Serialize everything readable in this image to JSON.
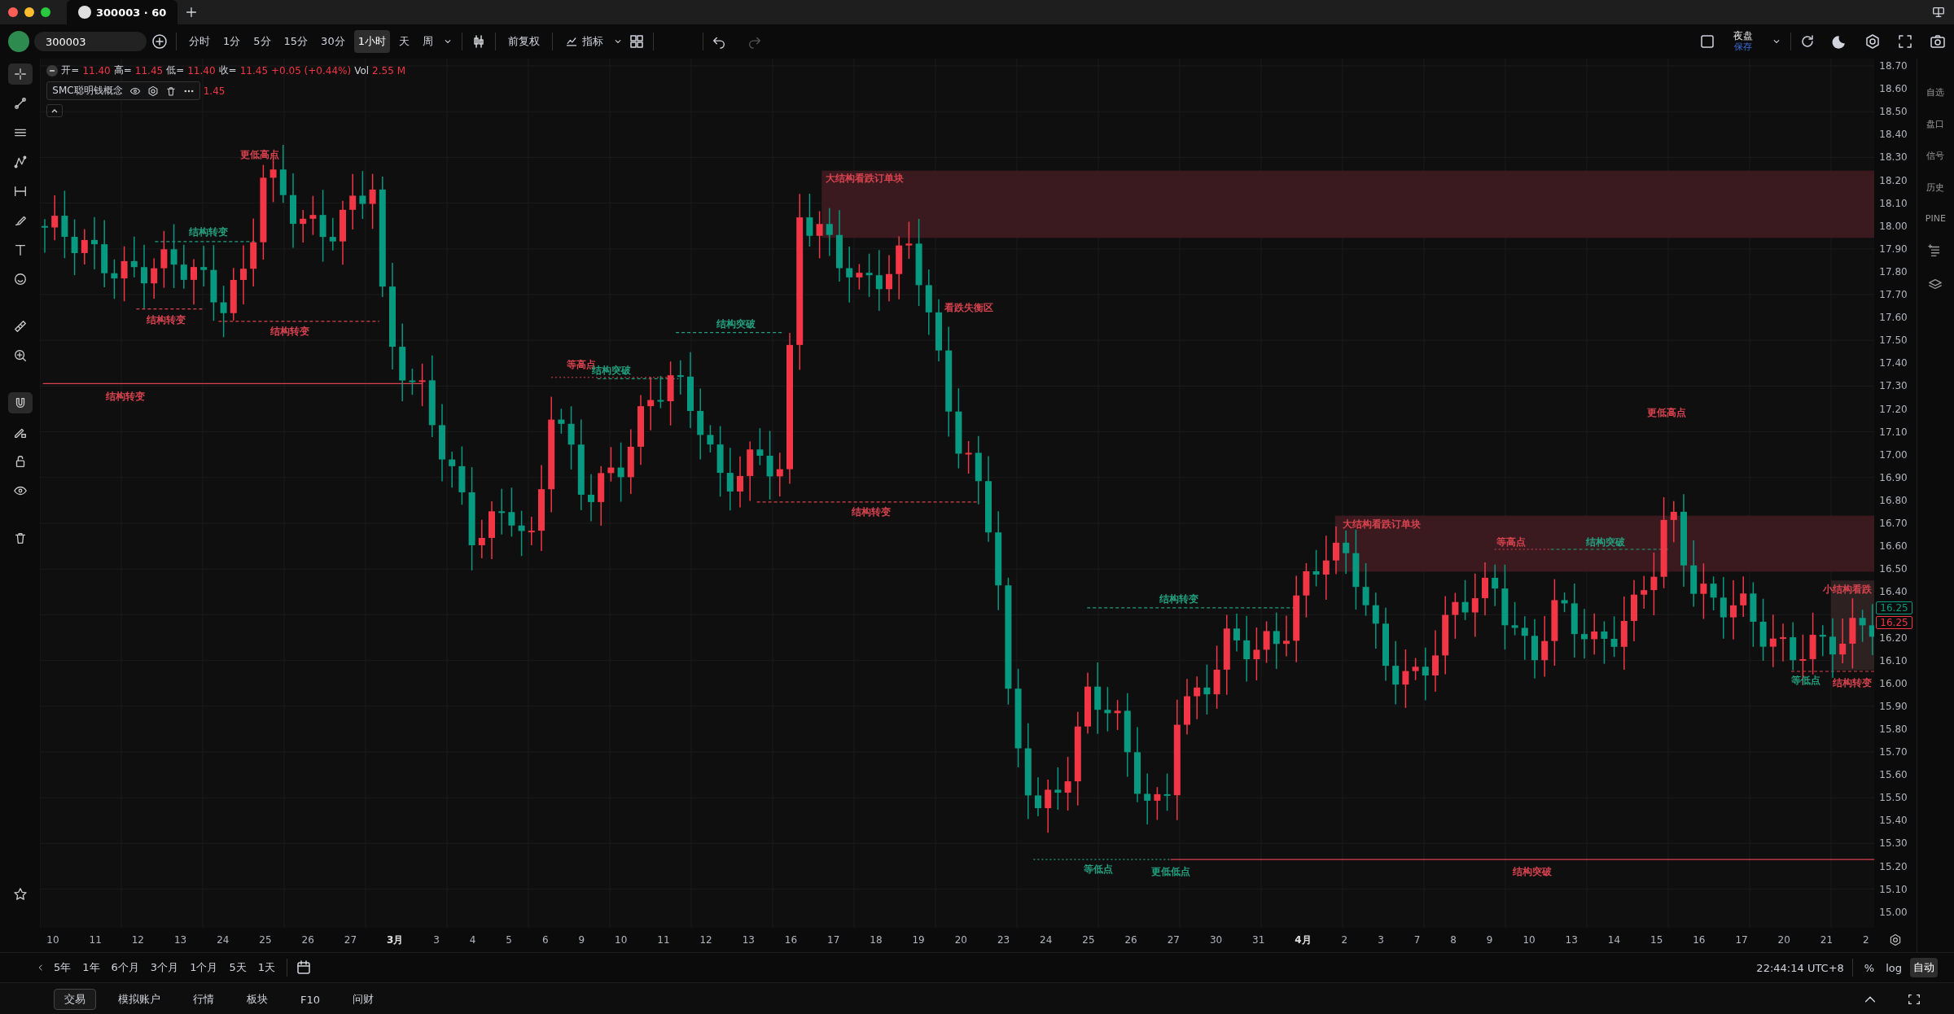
{
  "window": {
    "tab_title": "300003 · 60"
  },
  "toolbar": {
    "symbol": "300003",
    "intervals": [
      {
        "label": "分时",
        "selected": false
      },
      {
        "label": "1分",
        "selected": false
      },
      {
        "label": "5分",
        "selected": false
      },
      {
        "label": "15分",
        "selected": false
      },
      {
        "label": "30分",
        "selected": false
      },
      {
        "label": "1小时",
        "selected": true
      },
      {
        "label": "天",
        "selected": false
      },
      {
        "label": "周",
        "selected": false
      }
    ],
    "adjustment": "前复权",
    "indicators": "指标"
  },
  "session": {
    "label": "夜盘",
    "status": "保存"
  },
  "legend": {
    "fields": [
      {
        "label": "开=",
        "value": "11.40"
      },
      {
        "label": "高=",
        "value": "11.45"
      },
      {
        "label": "低=",
        "value": "11.40"
      },
      {
        "label": "收=",
        "value": "11.45"
      }
    ],
    "change": "+0.05 (+0.44%)",
    "volume_label": "Vol",
    "volume": "2.55 M"
  },
  "indicator": {
    "name": "SMC聪明钱概念",
    "value": "1.45"
  },
  "price_axis": {
    "labels": [
      "18.70",
      "18.60",
      "18.50",
      "18.40",
      "18.30",
      "18.20",
      "18.10",
      "18.00",
      "17.90",
      "17.80",
      "17.70",
      "17.60",
      "17.50",
      "17.40",
      "17.30",
      "17.20",
      "17.10",
      "17.00",
      "16.90",
      "16.80",
      "16.70",
      "16.60",
      "16.50",
      "16.40",
      "16.20",
      "16.10",
      "16.00",
      "15.90",
      "15.80",
      "15.70",
      "15.60",
      "15.50",
      "15.40",
      "15.30",
      "15.20",
      "15.10",
      "15.00"
    ],
    "badges": [
      {
        "text": "16.25",
        "color": "#089981"
      },
      {
        "text": "16.25",
        "color": "#f23645"
      }
    ]
  },
  "annotations": [
    {
      "text": "更低高点",
      "color": "#d9434f"
    },
    {
      "text": "结构转变",
      "color": "#22a07f"
    },
    {
      "text": "结构转变",
      "color": "#d9434f"
    },
    {
      "text": "结构转变",
      "color": "#d9434f"
    },
    {
      "text": "结构转变",
      "color": "#d9434f"
    },
    {
      "text": "等高点",
      "color": "#d9434f"
    },
    {
      "text": "结构突破",
      "color": "#22a07f"
    },
    {
      "text": "结构突破",
      "color": "#22a07f"
    },
    {
      "text": "大结构看跌订单块",
      "color": "#d9434f"
    },
    {
      "text": "看跌失衡区",
      "color": "#d9434f"
    },
    {
      "text": "结构转变",
      "color": "#d9434f"
    },
    {
      "text": "更低高点",
      "color": "#d9434f"
    },
    {
      "text": "大结构看跌订单块",
      "color": "#d9434f"
    },
    {
      "text": "等高点",
      "color": "#d9434f"
    },
    {
      "text": "结构突破",
      "color": "#22a07f"
    },
    {
      "text": "结构转变",
      "color": "#22a07f"
    },
    {
      "text": "等低点",
      "color": "#22a07f"
    },
    {
      "text": "更低低点",
      "color": "#22a07f"
    },
    {
      "text": "结构突破",
      "color": "#d9434f"
    },
    {
      "text": "小结构看跌",
      "color": "#d9434f"
    },
    {
      "text": "等低点",
      "color": "#22a07f"
    },
    {
      "text": "结构转变",
      "color": "#d9434f"
    }
  ],
  "date_axis": [
    {
      "label": "10",
      "kind": "day"
    },
    {
      "label": "11",
      "kind": "day"
    },
    {
      "label": "12",
      "kind": "day"
    },
    {
      "label": "13",
      "kind": "day"
    },
    {
      "label": "24",
      "kind": "day"
    },
    {
      "label": "25",
      "kind": "day"
    },
    {
      "label": "26",
      "kind": "day"
    },
    {
      "label": "27",
      "kind": "day"
    },
    {
      "label": "3月",
      "kind": "month"
    },
    {
      "label": "3",
      "kind": "day"
    },
    {
      "label": "4",
      "kind": "day"
    },
    {
      "label": "5",
      "kind": "day"
    },
    {
      "label": "6",
      "kind": "day"
    },
    {
      "label": "9",
      "kind": "day"
    },
    {
      "label": "10",
      "kind": "day"
    },
    {
      "label": "11",
      "kind": "day"
    },
    {
      "label": "12",
      "kind": "day"
    },
    {
      "label": "13",
      "kind": "day"
    },
    {
      "label": "16",
      "kind": "day"
    },
    {
      "label": "17",
      "kind": "day"
    },
    {
      "label": "18",
      "kind": "day"
    },
    {
      "label": "19",
      "kind": "day"
    },
    {
      "label": "20",
      "kind": "day"
    },
    {
      "label": "23",
      "kind": "day"
    },
    {
      "label": "24",
      "kind": "day"
    },
    {
      "label": "25",
      "kind": "day"
    },
    {
      "label": "26",
      "kind": "day"
    },
    {
      "label": "27",
      "kind": "day"
    },
    {
      "label": "30",
      "kind": "day"
    },
    {
      "label": "31",
      "kind": "day"
    },
    {
      "label": "4月",
      "kind": "month"
    },
    {
      "label": "2",
      "kind": "day"
    },
    {
      "label": "3",
      "kind": "day"
    },
    {
      "label": "7",
      "kind": "day"
    },
    {
      "label": "8",
      "kind": "day"
    },
    {
      "label": "9",
      "kind": "day"
    },
    {
      "label": "10",
      "kind": "day"
    },
    {
      "label": "13",
      "kind": "day"
    },
    {
      "label": "14",
      "kind": "day"
    },
    {
      "label": "15",
      "kind": "day"
    },
    {
      "label": "16",
      "kind": "day"
    },
    {
      "label": "17",
      "kind": "day"
    },
    {
      "label": "20",
      "kind": "day"
    },
    {
      "label": "21",
      "kind": "day"
    },
    {
      "label": "2",
      "kind": "day"
    }
  ],
  "ranges": [
    "5年",
    "1年",
    "6个月",
    "3个月",
    "1个月",
    "5天",
    "1天"
  ],
  "status": {
    "time": "22:44:14 UTC+8",
    "percent": "%",
    "log": "log",
    "auto": {
      "label": "自动",
      "selected": true
    }
  },
  "bottom_tabs": [
    {
      "label": "交易",
      "selected": true
    },
    {
      "label": "模拟账户",
      "selected": false
    },
    {
      "label": "行情",
      "selected": false
    },
    {
      "label": "板块",
      "selected": false
    },
    {
      "label": "F10",
      "selected": false
    },
    {
      "label": "问财",
      "selected": false
    }
  ],
  "right_sidebar": [
    "自选",
    "盘口",
    "信号",
    "历史",
    "PINE"
  ]
}
